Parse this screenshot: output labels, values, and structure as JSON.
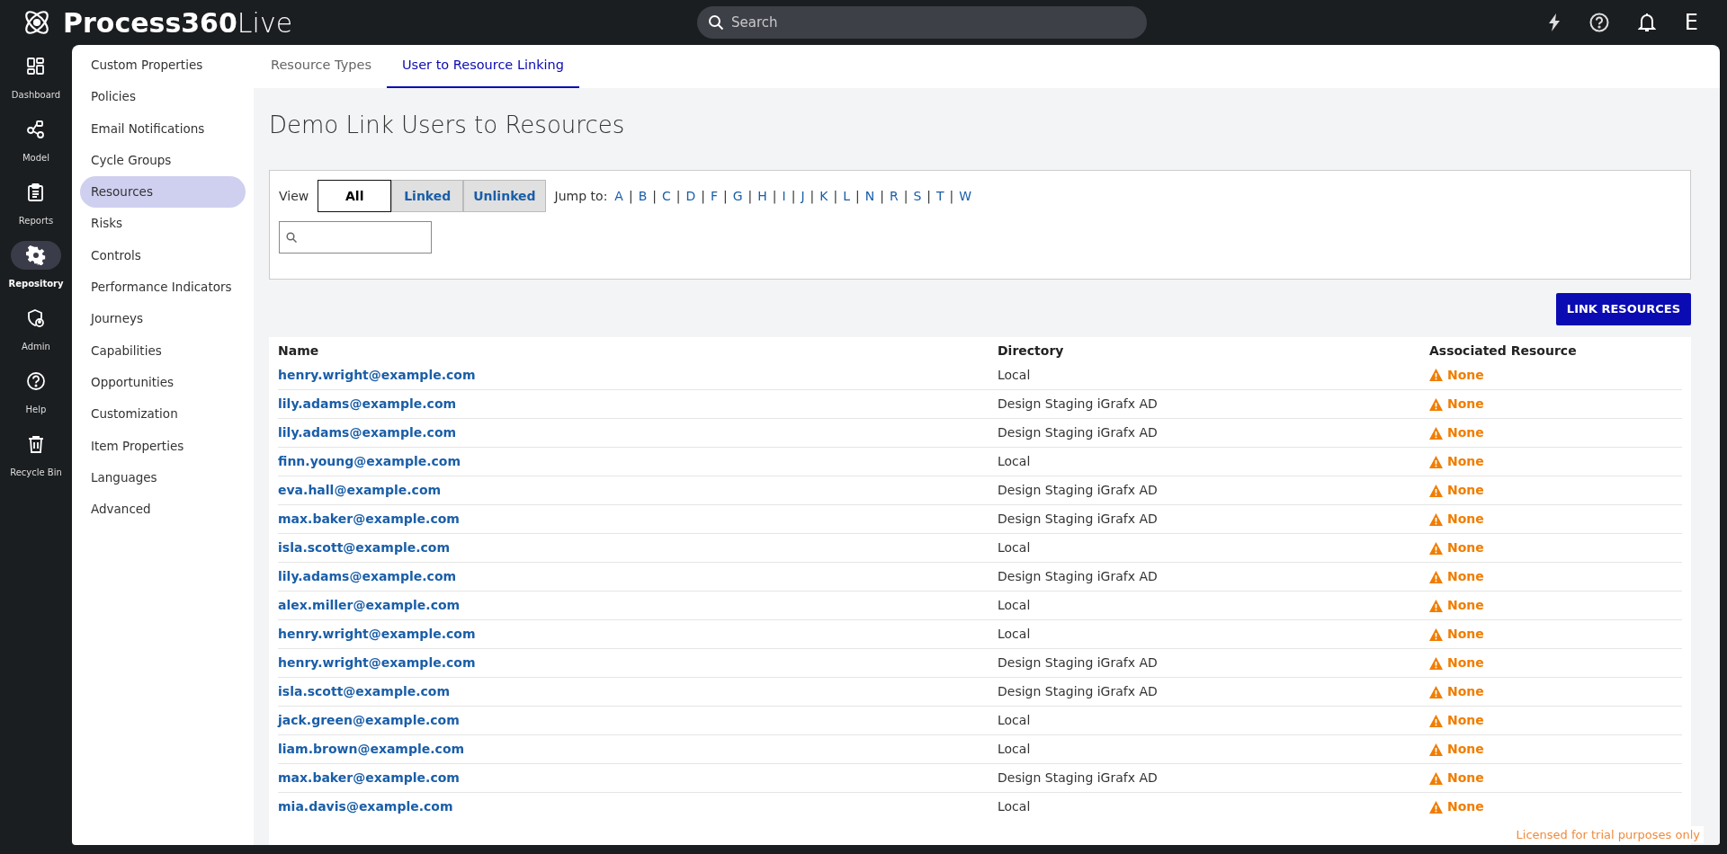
{
  "app": {
    "logo_bold": "Process360",
    "logo_light": "Live",
    "search": {
      "placeholder": "Search"
    },
    "user_initial": "E"
  },
  "rail": [
    {
      "label": "Dashboard",
      "selected": false
    },
    {
      "label": "Model",
      "selected": false
    },
    {
      "label": "Reports",
      "selected": false
    },
    {
      "label": "Repository",
      "selected": true
    },
    {
      "label": "Admin",
      "selected": false
    },
    {
      "label": "Help",
      "selected": false
    },
    {
      "label": "Recycle Bin",
      "selected": false
    }
  ],
  "sidebar": {
    "items": [
      {
        "label": "Custom Properties",
        "selected": false
      },
      {
        "label": "Policies",
        "selected": false
      },
      {
        "label": "Email Notifications",
        "selected": false
      },
      {
        "label": "Cycle Groups",
        "selected": false
      },
      {
        "label": "Resources",
        "selected": true
      },
      {
        "label": "Risks",
        "selected": false
      },
      {
        "label": "Controls",
        "selected": false
      },
      {
        "label": "Performance Indicators",
        "selected": false
      },
      {
        "label": "Journeys",
        "selected": false
      },
      {
        "label": "Capabilities",
        "selected": false
      },
      {
        "label": "Opportunities",
        "selected": false
      },
      {
        "label": "Customization",
        "selected": false
      },
      {
        "label": "Item Properties",
        "selected": false
      },
      {
        "label": "Languages",
        "selected": false
      },
      {
        "label": "Advanced",
        "selected": false
      }
    ]
  },
  "tabs": [
    {
      "label": "Resource Types",
      "selected": false
    },
    {
      "label": "User to Resource Linking",
      "selected": true
    }
  ],
  "page_title": "Demo Link Users to Resources",
  "filter": {
    "view_label": "View",
    "views": [
      {
        "label": "All",
        "selected": true
      },
      {
        "label": "Linked",
        "selected": false
      },
      {
        "label": "Unlinked",
        "selected": false
      }
    ],
    "jump_label": "Jump to:",
    "letters": [
      "A",
      "B",
      "C",
      "D",
      "F",
      "G",
      "H",
      "I",
      "J",
      "K",
      "L",
      "N",
      "R",
      "S",
      "T",
      "W"
    ],
    "separator": "|"
  },
  "link_button": "LINK RESOURCES",
  "table": {
    "columns": [
      "Name",
      "Directory",
      "Associated Resource"
    ],
    "rows": [
      {
        "name": "henry.wright@example.com",
        "directory": "Local",
        "resource": "None"
      },
      {
        "name": "lily.adams@example.com",
        "directory": "Design Staging iGrafx AD",
        "resource": "None"
      },
      {
        "name": "lily.adams@example.com",
        "directory": "Design Staging iGrafx AD",
        "resource": "None"
      },
      {
        "name": "finn.young@example.com",
        "directory": "Local",
        "resource": "None"
      },
      {
        "name": "eva.hall@example.com",
        "directory": "Design Staging iGrafx AD",
        "resource": "None"
      },
      {
        "name": "max.baker@example.com",
        "directory": "Design Staging iGrafx AD",
        "resource": "None"
      },
      {
        "name": "isla.scott@example.com",
        "directory": "Local",
        "resource": "None"
      },
      {
        "name": "lily.adams@example.com",
        "directory": "Design Staging iGrafx AD",
        "resource": "None"
      },
      {
        "name": "alex.miller@example.com",
        "directory": "Local",
        "resource": "None"
      },
      {
        "name": "henry.wright@example.com",
        "directory": "Local",
        "resource": "None"
      },
      {
        "name": "henry.wright@example.com",
        "directory": "Design Staging iGrafx AD",
        "resource": "None"
      },
      {
        "name": "isla.scott@example.com",
        "directory": "Design Staging iGrafx AD",
        "resource": "None"
      },
      {
        "name": "jack.green@example.com",
        "directory": "Local",
        "resource": "None"
      },
      {
        "name": "liam.brown@example.com",
        "directory": "Local",
        "resource": "None"
      },
      {
        "name": "max.baker@example.com",
        "directory": "Design Staging iGrafx AD",
        "resource": "None"
      },
      {
        "name": "mia.davis@example.com",
        "directory": "Local",
        "resource": "None"
      }
    ]
  },
  "license_note": "Licensed for trial purposes only"
}
